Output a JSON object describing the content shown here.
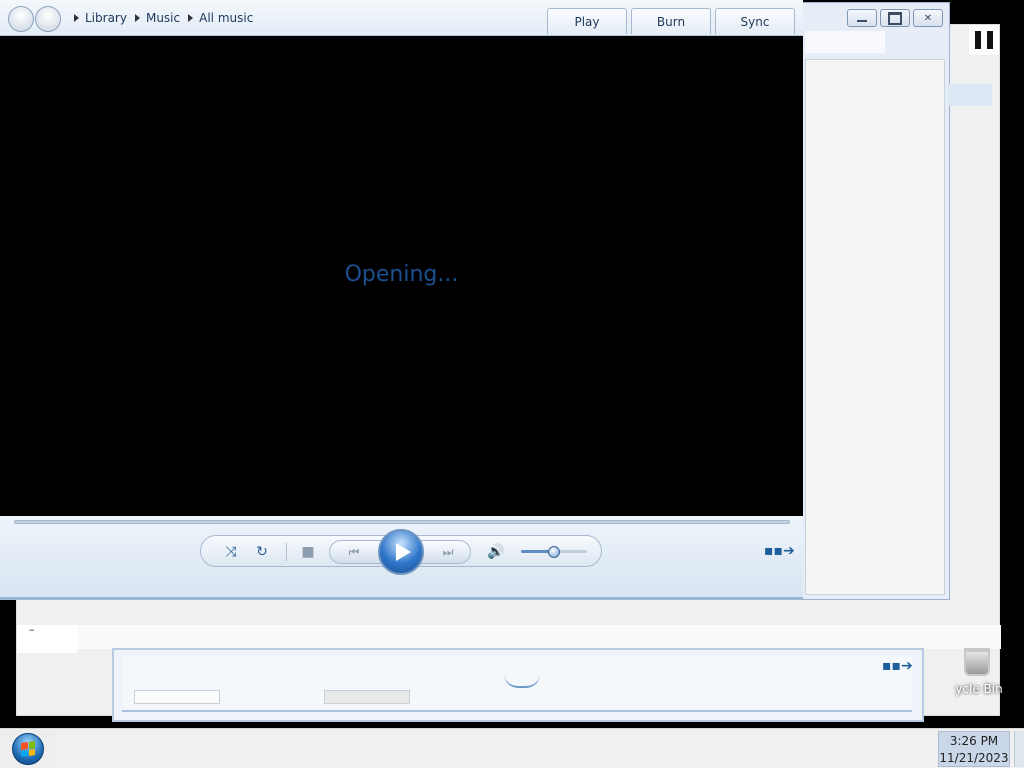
{
  "player": {
    "breadcrumb": [
      "Library",
      "Music",
      "All music"
    ],
    "tabs": [
      "Play",
      "Burn",
      "Sync"
    ],
    "status_text": "Opening...",
    "window_controls": [
      "minimize",
      "maximize",
      "close"
    ],
    "volume_level": 0.5,
    "icons": {
      "back": "back-arrow-icon",
      "forward": "forward-arrow-icon",
      "shuffle": "shuffle-icon",
      "repeat": "repeat-icon",
      "stop": "stop-icon",
      "previous": "previous-icon",
      "play": "play-icon",
      "next": "next-icon",
      "volume": "volume-icon",
      "switch_view": "switch-to-library-icon"
    }
  },
  "desktop": {
    "recycle_bin_label": "ycle Bin"
  },
  "taskbar": {
    "time": "3:26 PM",
    "date": "11/21/2023"
  },
  "colors": {
    "accent": "#2f76c9",
    "status_text": "#1b4f8f",
    "video_bg": "#000000"
  }
}
